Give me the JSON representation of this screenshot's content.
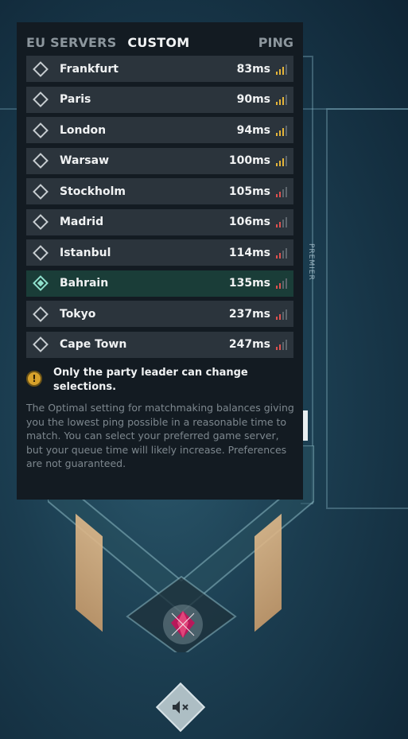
{
  "header": {
    "tab_servers": "EU SERVERS",
    "tab_custom": "CUSTOM",
    "ping_label": "PING"
  },
  "servers": [
    {
      "name": "Frankfurt",
      "ping": "83ms",
      "signal_bars": 3,
      "signal_color": "#e5b53a",
      "selected": false
    },
    {
      "name": "Paris",
      "ping": "90ms",
      "signal_bars": 3,
      "signal_color": "#e5b53a",
      "selected": false
    },
    {
      "name": "London",
      "ping": "94ms",
      "signal_bars": 3,
      "signal_color": "#e5b53a",
      "selected": false
    },
    {
      "name": "Warsaw",
      "ping": "100ms",
      "signal_bars": 3,
      "signal_color": "#e5b53a",
      "selected": false
    },
    {
      "name": "Stockholm",
      "ping": "105ms",
      "signal_bars": 2,
      "signal_color": "#e0524f",
      "selected": false
    },
    {
      "name": "Madrid",
      "ping": "106ms",
      "signal_bars": 2,
      "signal_color": "#e0524f",
      "selected": false
    },
    {
      "name": "Istanbul",
      "ping": "114ms",
      "signal_bars": 2,
      "signal_color": "#e0524f",
      "selected": false
    },
    {
      "name": "Bahrain",
      "ping": "135ms",
      "signal_bars": 2,
      "signal_color": "#e0524f",
      "selected": true
    },
    {
      "name": "Tokyo",
      "ping": "237ms",
      "signal_bars": 2,
      "signal_color": "#e0524f",
      "selected": false
    },
    {
      "name": "Cape Town",
      "ping": "247ms",
      "signal_bars": 2,
      "signal_color": "#e0524f",
      "selected": false
    }
  ],
  "notice": {
    "icon": "warning-icon",
    "text": "Only the party leader can change selections."
  },
  "description": "The Optimal setting for matchmaking balances giving you the lowest ping possible in a reasonable time to match. You can select your preferred game server, but your queue time will likely increase. Preferences are not guaranteed.",
  "side_label": "PREMIER",
  "colors": {
    "panel_bg": "#131b22",
    "row_bg": "#2b343c",
    "selected_row_bg": "#1a3d38",
    "selected_accent": "#8fe0cc",
    "warning": "#d8a22b"
  }
}
